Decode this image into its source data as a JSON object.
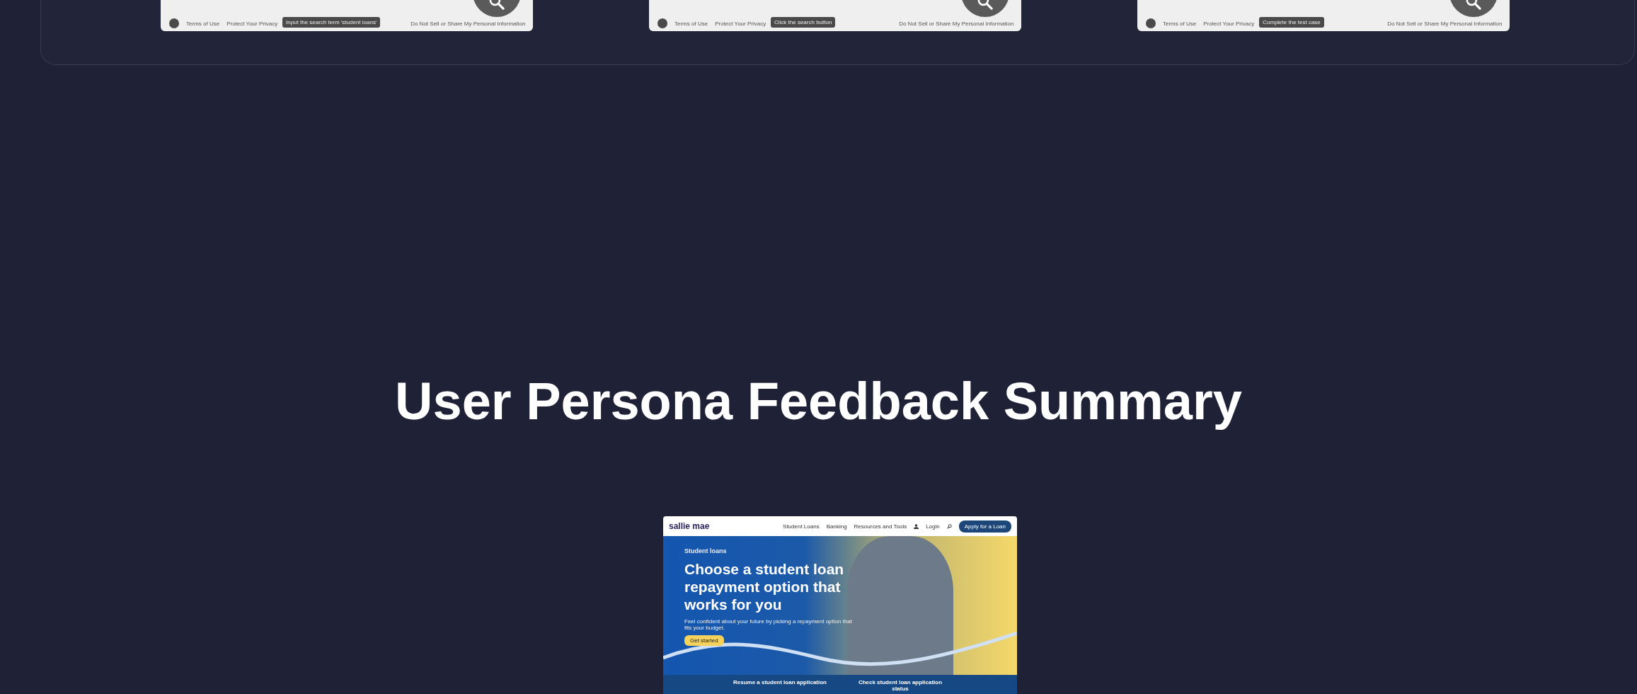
{
  "task_cards": [
    {
      "links_left": [
        "Terms of Use",
        "Protect Your Privacy"
      ],
      "tooltip": "Input the search term 'student loans'",
      "links_right": [
        "Do Not Sell or Share My Personal Information"
      ]
    },
    {
      "links_left": [
        "Terms of Use",
        "Protect Your Privacy"
      ],
      "tooltip": "Click the search button",
      "links_right": [
        "Do Not Sell or Share My Personal Information"
      ]
    },
    {
      "links_left": [
        "Terms of Use",
        "Protect Your Privacy"
      ],
      "tooltip": "Complete the test case",
      "links_right": [
        "Do Not Sell or Share My Personal Information"
      ]
    }
  ],
  "heading": "User Persona Feedback Summary",
  "preview": {
    "logo": "sallie mae",
    "nav": [
      "Student Loans",
      "Banking",
      "Resources and Tools"
    ],
    "login": "Login",
    "cta": "Apply for a Loan",
    "eyebrow": "Student loans",
    "title": "Choose a student loan repayment option that works for you",
    "subtitle": "Feel confident about your future by picking a repayment option that fits your budget.",
    "button": "Get started",
    "bottom_links": [
      "Resume a student loan application",
      "Check student loan application status"
    ]
  }
}
